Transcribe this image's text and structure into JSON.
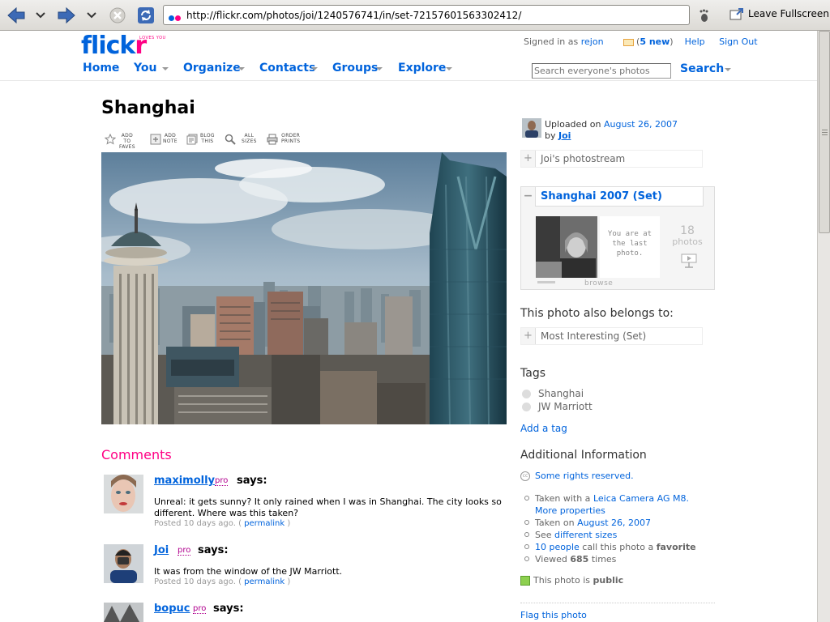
{
  "browser": {
    "url": "http://flickr.com/photos/joi/1240576741/in/set-72157601563302412/",
    "leave_fullscreen": "Leave Fullscreen"
  },
  "header": {
    "logo_main": "flick",
    "logo_r": "r",
    "logo_tagline": "LOVES YOU",
    "signed_in_prefix": "Signed in as",
    "username": "rejon",
    "new_count": "5 new",
    "help": "Help",
    "sign_out": "Sign Out",
    "nav": [
      "Home",
      "You",
      "Organize",
      "Contacts",
      "Groups",
      "Explore"
    ],
    "search_placeholder": "Search everyone's photos",
    "search_button": "Search"
  },
  "photo": {
    "title": "Shanghai",
    "tools": [
      {
        "line1": "ADD TO",
        "line2": "FAVES"
      },
      {
        "line1": "ADD",
        "line2": "NOTE"
      },
      {
        "line1": "BLOG",
        "line2": "THIS"
      },
      {
        "line1": "ALL",
        "line2": "SIZES"
      },
      {
        "line1": "ORDER",
        "line2": "PRINTS"
      }
    ]
  },
  "comments": {
    "title": "Comments",
    "pro_label": "pro",
    "says": "says:",
    "posted_prefix": "Posted 10 days ago. (",
    "permalink": "permalink",
    "posted_suffix": ")",
    "items": [
      {
        "author": "maximolly",
        "text_line1": "Unreal: it gets sunny? It only rained when I was in Shanghai. The city looks so",
        "text_line2": "different. Where was this taken?"
      },
      {
        "author": "Joi",
        "text_line1": "It was from the window of the JW Marriott."
      },
      {
        "author": "bopuc"
      }
    ]
  },
  "sidebar": {
    "uploaded_on": "Uploaded on",
    "upload_date": "August 26, 2007",
    "by": "by",
    "owner": "Joi",
    "photostream": "Joi's photostream",
    "set_title": "Shanghai 2007 (Set)",
    "set_here_line1": "You are at",
    "set_here_line2": "the last",
    "set_here_line3": "photo.",
    "set_count": "18",
    "set_count_word": "photos",
    "browse": "browse",
    "belongs_to": "This photo also belongs to:",
    "most_interesting": "Most Interesting (Set)",
    "tags_title": "Tags",
    "tags": [
      "Shanghai",
      "JW Marriott"
    ],
    "add_tag": "Add a tag",
    "info_title": "Additional Information",
    "rights": "Some rights reserved.",
    "taken_with_prefix": "Taken with a",
    "camera": "Leica Camera AG M8.",
    "more_properties": "More properties",
    "taken_on_prefix": "Taken on",
    "taken_date": "August 26, 2007",
    "see_prefix": "See",
    "different_sizes": "different sizes",
    "favorite_people": "10 people",
    "favorite_mid": "call this photo a",
    "favorite_word": "favorite",
    "viewed_prefix": "Viewed",
    "viewed_count": "685",
    "viewed_suffix": "times",
    "public_prefix": "This photo is",
    "public_word": "public",
    "flag": "Flag this photo"
  }
}
